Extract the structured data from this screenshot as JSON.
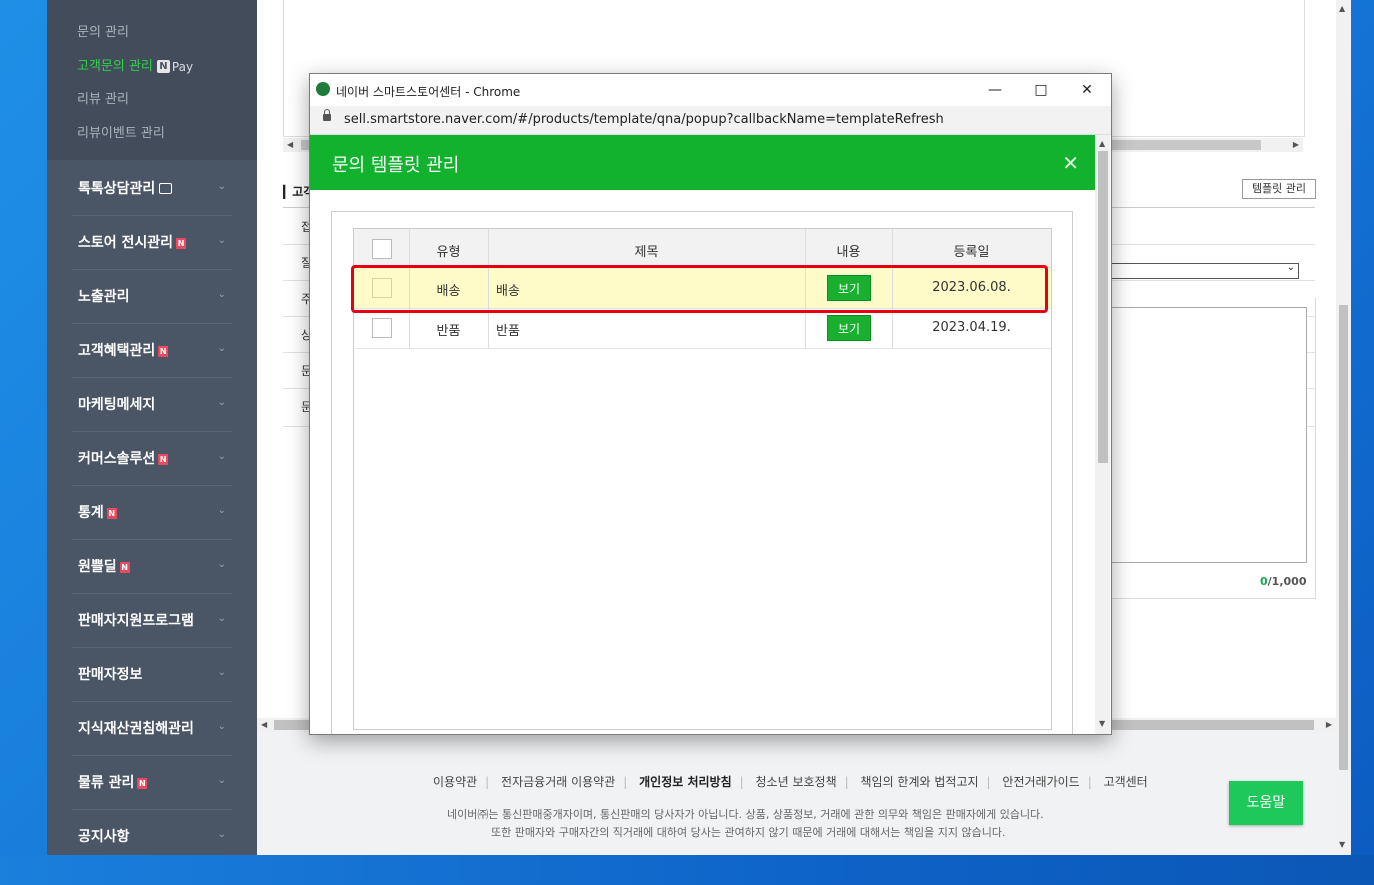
{
  "sidebar": {
    "sub_items": [
      {
        "label": "문의 관리"
      },
      {
        "label": "고객문의 관리",
        "badge": "N",
        "suffix": "Pay"
      },
      {
        "label": "리뷰 관리"
      },
      {
        "label": "리뷰이벤트 관리"
      }
    ],
    "menu": [
      {
        "label": "톡톡상담관리"
      },
      {
        "label": "스토어 전시관리",
        "badge": "N"
      },
      {
        "label": "노출관리"
      },
      {
        "label": "고객혜택관리",
        "badge": "N"
      },
      {
        "label": "마케팅메세지"
      },
      {
        "label": "커머스솔루션",
        "badge": "N"
      },
      {
        "label": "통계",
        "badge": "N"
      },
      {
        "label": "원쁠딜",
        "badge": "N"
      },
      {
        "label": "판매자지원프로그램"
      },
      {
        "label": "판매자정보"
      },
      {
        "label": "지식재산권침해관리"
      },
      {
        "label": "물류 관리",
        "badge": "N"
      },
      {
        "label": "공지사항"
      }
    ]
  },
  "background": {
    "section_title": "고객",
    "template_button": "템플릿 관리",
    "row_chars": [
      "접",
      "질",
      "주",
      "상",
      "문",
      "문"
    ],
    "char_count_current": "0",
    "char_count_max": "/1,000",
    "footer_links": [
      "이용약관",
      "전자금융거래 이용약관",
      "개인정보 처리방침",
      "청소년 보호정책",
      "책임의 한계와 법적고지",
      "안전거래가이드",
      "고객센터"
    ],
    "footer_note_1": "네이버㈜는 통신판매중개자이며, 통신판매의 당사자가 아닙니다. 상품, 상품정보, 거래에 관한 의무와 책임은 판매자에게 있습니다.",
    "footer_note_2": "또한 판매자와 구매자간의 직거래에 대하여 당사는 관여하지 않기 때문에 거래에 대해서는 책임을 지지 않습니다.",
    "help_button": "도움말"
  },
  "popup": {
    "window_title": "네이버 스마트스토어센터 - Chrome",
    "url": "sell.smartstore.naver.com/#/products/template/qna/popup?callbackName=templateRefresh",
    "header_title": "문의 템플릿 관리",
    "table": {
      "headers": [
        "유형",
        "제목",
        "내용",
        "등록일"
      ],
      "rows": [
        {
          "type": "배송",
          "title": "배송",
          "view": "보기",
          "date": "2023.06.08."
        },
        {
          "type": "반품",
          "title": "반품",
          "view": "보기",
          "date": "2023.04.19."
        }
      ]
    }
  },
  "colors": {
    "green": "#12b22f",
    "sidebar": "#4a5565",
    "highlight_frame": "#e60012",
    "highlight_row": "#fffbc9"
  }
}
